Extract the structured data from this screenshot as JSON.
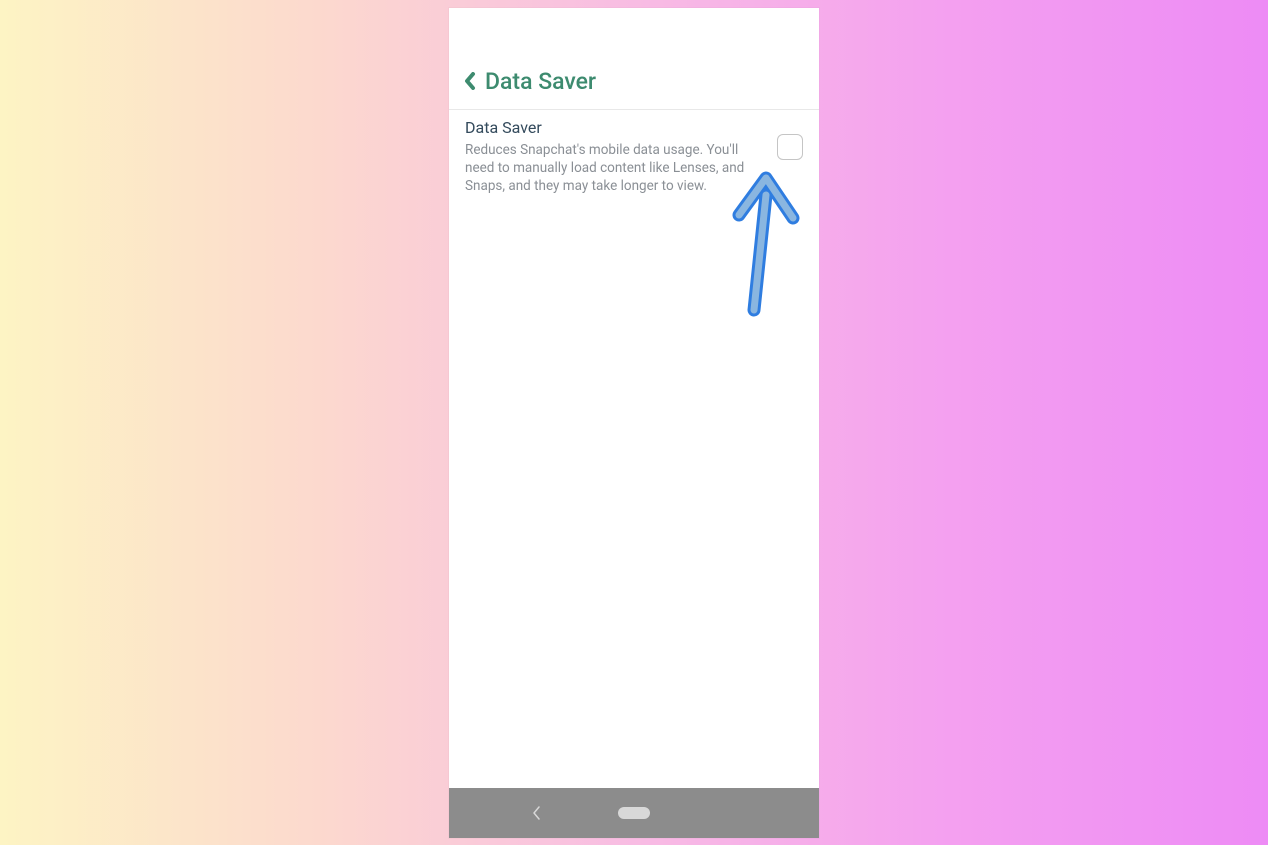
{
  "header": {
    "title": "Data Saver"
  },
  "setting": {
    "title": "Data Saver",
    "description": "Reduces Snapchat's mobile data usage. You'll need to manually load content like Lenses, and Snaps, and they may take longer to view."
  }
}
